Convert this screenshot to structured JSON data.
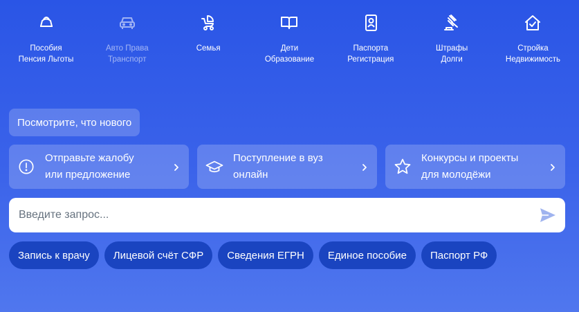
{
  "categories": [
    {
      "line1": "Пособия",
      "line2": "Пенсия Льготы",
      "icon": "wallet-icon"
    },
    {
      "line1": "Авто Права",
      "line2": "Транспорт",
      "icon": "car-icon"
    },
    {
      "line1": "Семья",
      "line2": "",
      "icon": "stroller-icon"
    },
    {
      "line1": "Дети",
      "line2": "Образование",
      "icon": "book-icon"
    },
    {
      "line1": "Паспорта",
      "line2": "Регистрация",
      "icon": "passport-icon"
    },
    {
      "line1": "Штрафы",
      "line2": "Долги",
      "icon": "gavel-icon"
    },
    {
      "line1": "Стройка",
      "line2": "Недвижимость",
      "icon": "house-icon"
    }
  ],
  "news_chip": "Посмотрите, что нового",
  "cards": [
    {
      "line1": "Отправьте жалобу",
      "line2": "или предложение",
      "icon": "alert-circle-icon"
    },
    {
      "line1": "Поступление в вуз",
      "line2": "онлайн",
      "icon": "graduation-cap-icon"
    },
    {
      "line1": "Конкурсы и проекты",
      "line2": "для молодёжи",
      "icon": "star-icon"
    }
  ],
  "search": {
    "placeholder": "Введите запрос...",
    "value": ""
  },
  "quick_links": [
    "Запись к врачу",
    "Лицевой счёт СФР",
    "Сведения ЕГРН",
    "Единое пособие",
    "Паспорт РФ"
  ],
  "colors": {
    "background_top": "#2a55e6",
    "background_bottom": "#5077ee",
    "pill": "#1a44c0",
    "send_icon": "#9fb3ef"
  }
}
